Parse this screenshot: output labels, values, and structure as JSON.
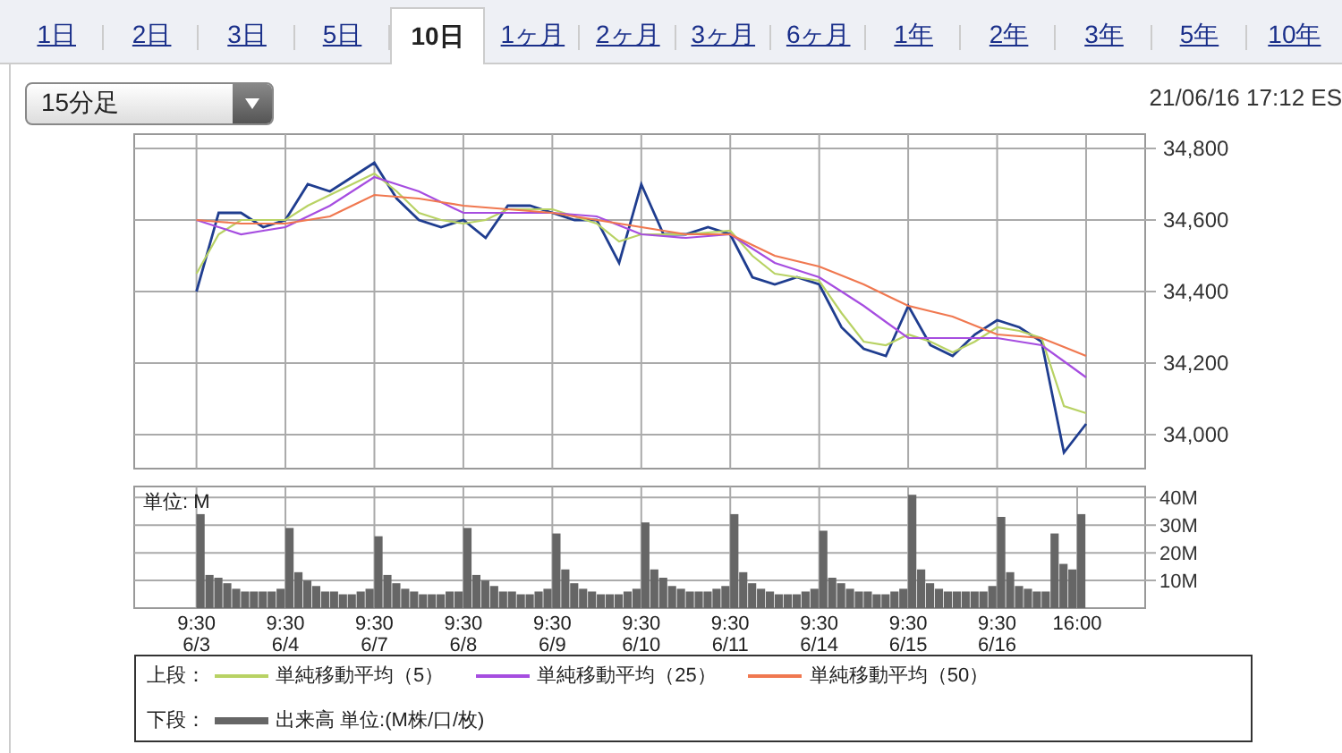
{
  "tabs": [
    {
      "label": "1日",
      "selected": false
    },
    {
      "label": "2日",
      "selected": false
    },
    {
      "label": "3日",
      "selected": false
    },
    {
      "label": "5日",
      "selected": false
    },
    {
      "label": "10日",
      "selected": true
    },
    {
      "label": "1ヶ月",
      "selected": false
    },
    {
      "label": "2ヶ月",
      "selected": false
    },
    {
      "label": "3ヶ月",
      "selected": false
    },
    {
      "label": "6ヶ月",
      "selected": false
    },
    {
      "label": "1年",
      "selected": false
    },
    {
      "label": "2年",
      "selected": false
    },
    {
      "label": "3年",
      "selected": false
    },
    {
      "label": "5年",
      "selected": false
    },
    {
      "label": "10年",
      "selected": false
    }
  ],
  "interval_select": {
    "value": "15分足"
  },
  "timestamp": "21/06/16 17:12 ES",
  "price_chart": {
    "chart_data": {
      "type": "line",
      "categories": [
        null,
        null,
        null,
        null,
        null,
        null,
        null,
        null,
        null,
        null,
        null,
        null,
        null,
        null,
        null,
        null,
        null,
        null,
        null,
        null,
        null,
        null,
        null,
        null,
        null,
        null,
        null,
        null,
        null,
        null,
        null,
        null,
        null,
        null,
        null,
        null,
        null,
        null,
        null,
        null,
        null
      ],
      "grid": true,
      "ylim": [
        33905,
        34840
      ],
      "yticks": [
        {
          "value": 34000,
          "label": "34,000"
        },
        {
          "value": 34200,
          "label": "34,200"
        },
        {
          "value": 34400,
          "label": "34,400"
        },
        {
          "value": 34600,
          "label": "34,600"
        },
        {
          "value": 34800,
          "label": "34,800"
        }
      ],
      "series": [
        {
          "color": "#1f3d8f",
          "values": [
            34400,
            34620,
            34620,
            34580,
            34600,
            34700,
            34680,
            34720,
            34760,
            34660,
            34600,
            34580,
            34600,
            34550,
            34640,
            34640,
            34620,
            34600,
            34600,
            34480,
            34700,
            34560,
            34560,
            34580,
            34560,
            34440,
            34420,
            34440,
            34420,
            34300,
            34240,
            34220,
            34360,
            34250,
            34220,
            34280,
            34320,
            34300,
            34260,
            33950,
            34030
          ]
        },
        {
          "color": "#b8d264",
          "values": [
            34450,
            34560,
            34600,
            34600,
            34600,
            34640,
            34670,
            34700,
            34730,
            34680,
            34620,
            34600,
            34590,
            34600,
            34630,
            34630,
            34630,
            34610,
            34590,
            34540,
            34560,
            34560,
            34560,
            34565,
            34570,
            34500,
            34450,
            34440,
            34430,
            34340,
            34260,
            34250,
            34280,
            34260,
            34230,
            34260,
            34300,
            34290,
            34270,
            34080,
            34060
          ]
        },
        {
          "color": "#a64de0",
          "values": [
            34600,
            34580,
            34560,
            34570,
            34580,
            34610,
            34640,
            34680,
            34720,
            34700,
            34680,
            34650,
            34620,
            34620,
            34620,
            34620,
            34620,
            34615,
            34610,
            34585,
            34560,
            34555,
            34550,
            34555,
            34560,
            34520,
            34480,
            34460,
            34440,
            34400,
            34360,
            34315,
            34270,
            34270,
            34270,
            34270,
            34270,
            34260,
            34250,
            34205,
            34160
          ]
        },
        {
          "color": "#f07850",
          "values": [
            34600,
            34595,
            34590,
            34590,
            34590,
            34600,
            34610,
            34640,
            34670,
            34665,
            34660,
            34650,
            34640,
            34635,
            34630,
            34625,
            34620,
            34610,
            34600,
            34590,
            34580,
            34570,
            34560,
            34560,
            34560,
            34530,
            34500,
            34485,
            34470,
            34445,
            34420,
            34390,
            34360,
            34345,
            34330,
            34305,
            34280,
            34275,
            34270,
            34245,
            34220
          ]
        }
      ]
    }
  },
  "volume_chart": {
    "unit_label": "単位: M",
    "chart_data": {
      "type": "bar",
      "categories": [
        "9:30\n6/3",
        null,
        null,
        null,
        null,
        null,
        null,
        null,
        null,
        null,
        "9:30\n6/4",
        null,
        null,
        null,
        null,
        null,
        null,
        null,
        null,
        null,
        "9:30\n6/7",
        null,
        null,
        null,
        null,
        null,
        null,
        null,
        null,
        null,
        "9:30\n6/8",
        null,
        null,
        null,
        null,
        null,
        null,
        null,
        null,
        null,
        "9:30\n6/9",
        null,
        null,
        null,
        null,
        null,
        null,
        null,
        null,
        null,
        "9:30\n6/10",
        null,
        null,
        null,
        null,
        null,
        null,
        null,
        null,
        null,
        "9:30\n6/11",
        null,
        null,
        null,
        null,
        null,
        null,
        null,
        null,
        null,
        "9:30\n6/14",
        null,
        null,
        null,
        null,
        null,
        null,
        null,
        null,
        null,
        "9:30\n6/15",
        null,
        null,
        null,
        null,
        null,
        null,
        null,
        null,
        null,
        "9:30\n6/16",
        null,
        null,
        null,
        null,
        null,
        null,
        null,
        null,
        "16:00"
      ],
      "grid": true,
      "ylim": [
        0,
        44
      ],
      "yticks": [
        {
          "value": 10,
          "label": "10M"
        },
        {
          "value": 20,
          "label": "20M"
        },
        {
          "value": 30,
          "label": "30M"
        },
        {
          "value": 40,
          "label": "40M"
        }
      ],
      "series": [
        {
          "color": "#666666",
          "values": [
            34,
            12,
            11,
            9,
            7,
            6,
            6,
            6,
            6,
            7,
            29,
            13,
            10,
            8,
            6,
            6,
            5,
            5,
            6,
            7,
            26,
            12,
            9,
            7,
            6,
            5,
            5,
            5,
            6,
            6,
            29,
            12,
            10,
            8,
            6,
            6,
            5,
            5,
            6,
            7,
            27,
            14,
            9,
            7,
            6,
            5,
            5,
            5,
            6,
            7,
            31,
            14,
            11,
            8,
            7,
            6,
            6,
            6,
            7,
            8,
            34,
            13,
            9,
            7,
            6,
            5,
            5,
            5,
            6,
            7,
            28,
            11,
            9,
            7,
            6,
            6,
            5,
            5,
            6,
            7,
            41,
            14,
            9,
            7,
            6,
            6,
            6,
            6,
            6,
            8,
            33,
            13,
            8,
            7,
            6,
            6,
            27,
            16,
            14,
            34
          ]
        }
      ]
    }
  },
  "legend": {
    "upper": {
      "label": "上段：",
      "items": [
        {
          "label": "単純移動平均（5）",
          "color": "#b8d264"
        },
        {
          "label": "単純移動平均（25）",
          "color": "#a64de0"
        },
        {
          "label": "単純移動平均（50）",
          "color": "#f07850"
        }
      ]
    },
    "lower": {
      "label": "下段：",
      "items": [
        {
          "label": "出来高 単位:(M株/口/枚)",
          "color": "#666666"
        }
      ]
    }
  }
}
